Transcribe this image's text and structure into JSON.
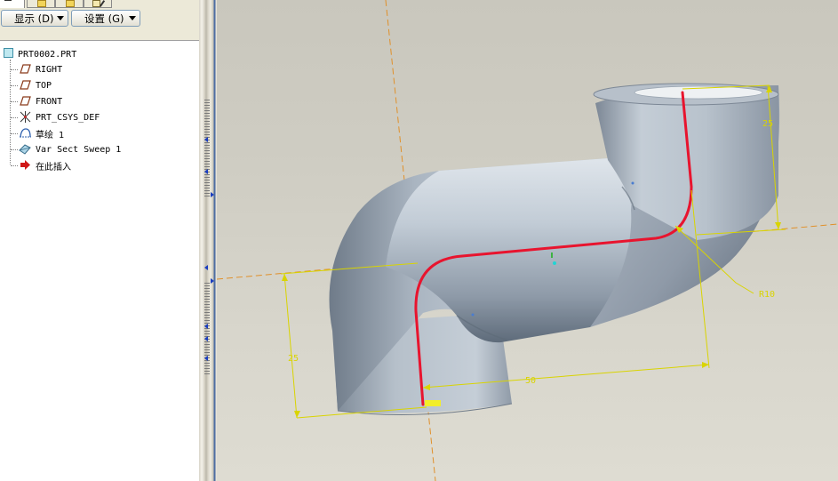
{
  "toolbar": {
    "show_button": "显示 (D)",
    "settings_button": "设置 (G)"
  },
  "model_tree": {
    "root": "PRT0002.PRT",
    "items": [
      {
        "label": "RIGHT",
        "icon": "datum-plane-icon"
      },
      {
        "label": "TOP",
        "icon": "datum-plane-icon"
      },
      {
        "label": "FRONT",
        "icon": "datum-plane-icon"
      },
      {
        "label": "PRT_CSYS_DEF",
        "icon": "coordinate-system-icon"
      },
      {
        "label": "草绘 1",
        "icon": "sketch-icon"
      },
      {
        "label": "Var Sect Sweep 1",
        "icon": "sweep-feature-icon"
      },
      {
        "label": "在此插入",
        "icon": "insert-here-arrow-icon"
      }
    ]
  },
  "viewport": {
    "dimensions": {
      "height_top": "25",
      "height_left": "25",
      "length": "50",
      "radius": "R10"
    }
  },
  "colors": {
    "trajectory": "#e8142e",
    "dimension": "#d9d400",
    "datum_axis": "#e0902a",
    "pipe": "#a9b4c0",
    "viewport_bg": "#cfcdc3"
  }
}
